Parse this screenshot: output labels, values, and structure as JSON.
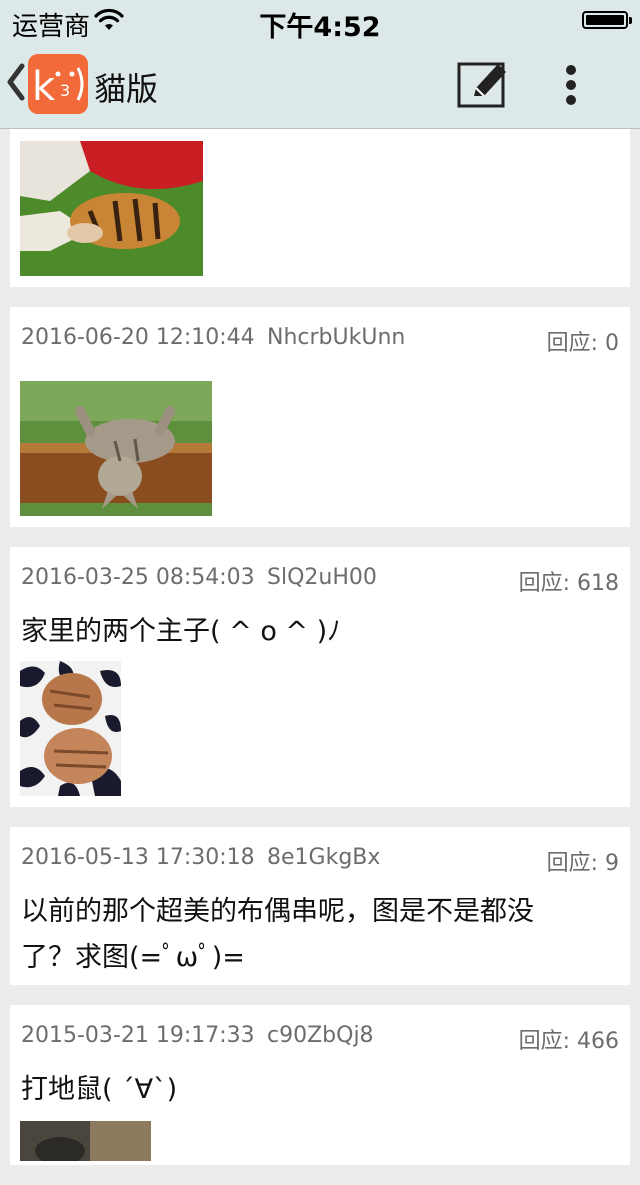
{
  "status_bar": {
    "carrier": "运营商",
    "time": "下午4:52"
  },
  "nav": {
    "title": "貓版",
    "logo_text": "k ˙3˙)"
  },
  "posts": [
    {
      "date": "2016-06-20 12:10:44",
      "uid": "NhcrbUkUnn",
      "reply": "回应: 0",
      "text": ""
    },
    {
      "date": "2016-03-25 08:54:03",
      "uid": "SlQ2uH00",
      "reply": "回应: 618",
      "text": "家里的两个主子( ^ o ^ )ﾉ"
    },
    {
      "date": "2016-05-13 17:30:18",
      "uid": "8e1GkgBx",
      "reply": "回应: 9",
      "text": "以前的那个超美的布偶串呢，图是不是都没了？求图(=ﾟωﾟ)="
    },
    {
      "date": "2015-03-21 19:17:33",
      "uid": "c90ZbQj8",
      "reply": "回应: 466",
      "text": "打地鼠( ´∀`)"
    }
  ],
  "colors": {
    "bar_bg": "#dde8e8",
    "logo_orange": "#f26a3a",
    "meta_gray": "#6c6c6c"
  },
  "icons": [
    "wifi-icon",
    "battery-icon",
    "back-chevron-icon",
    "compose-icon",
    "more-vertical-icon"
  ]
}
